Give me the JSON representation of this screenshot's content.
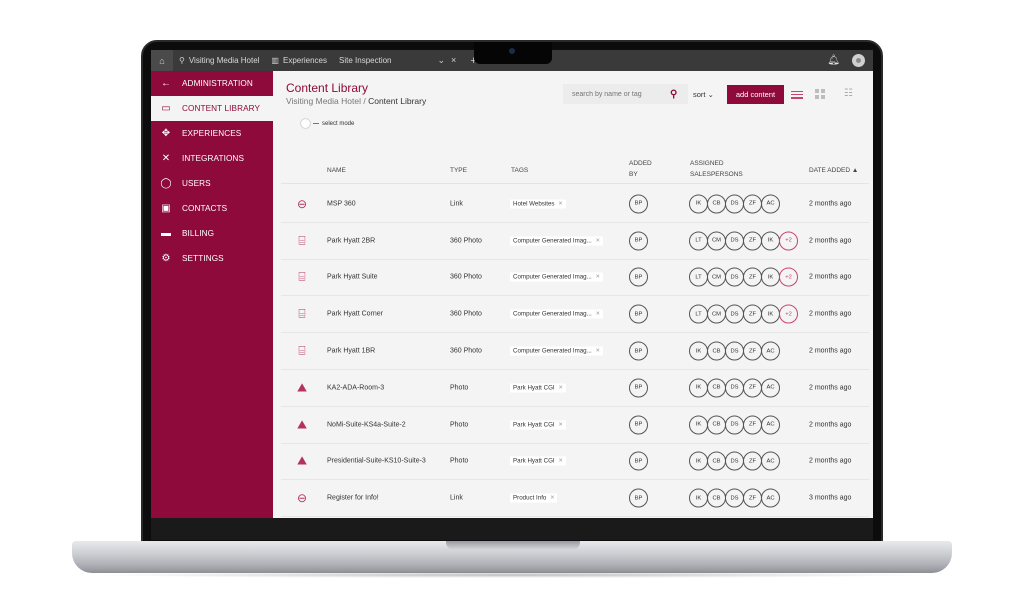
{
  "topbar": {
    "home_icon": "home-icon",
    "tabs": [
      {
        "icon": "location-pin-icon",
        "label": "Visiting Media Hotel"
      },
      {
        "icon": "map-book-icon",
        "label": "Experiences"
      },
      {
        "icon": "",
        "label": "Site Inspection"
      }
    ],
    "chevron": "⌄",
    "close": "×",
    "plus": "+",
    "bell": "♫",
    "bell_icon": "bell-icon",
    "avatar_icon": "user-avatar-icon"
  },
  "sidebar": {
    "items": [
      {
        "icon": "←",
        "label": "ADMINISTRATION",
        "active": false
      },
      {
        "icon": "▭",
        "label": "CONTENT LIBRARY",
        "active": true
      },
      {
        "icon": "✥",
        "label": "EXPERIENCES",
        "active": false
      },
      {
        "icon": "✕",
        "label": "INTEGRATIONS",
        "active": false
      },
      {
        "icon": "◯",
        "label": "USERS",
        "active": false
      },
      {
        "icon": "▣",
        "label": "CONTACTS",
        "active": false
      },
      {
        "icon": "▬",
        "label": "BILLING",
        "active": false
      },
      {
        "icon": "⚙",
        "label": "SETTINGS",
        "active": false
      }
    ]
  },
  "header": {
    "title": "Content Library",
    "breadcrumb_root": "Visiting Media Hotel",
    "breadcrumb_sep": "/",
    "breadcrumb_current": "Content Library",
    "select_mode_label": "select mode",
    "search_placeholder": "search by name or tag",
    "search_value": "",
    "sort_label": "sort ⌄",
    "add_button": "add content"
  },
  "table": {
    "columns": {
      "name": "NAME",
      "type": "TYPE",
      "tags": "TAGS",
      "added_by_1": "ADDED",
      "added_by_2": "BY",
      "assigned_1": "ASSIGNED",
      "assigned_2": "SALESPERSONS",
      "date_added": "DATE ADDED ▲"
    },
    "rows": [
      {
        "icon": "link-icon",
        "glyph": "⊖",
        "name": "MSP 360",
        "type": "Link",
        "tag": "Hotel Websites",
        "added_by": "BP",
        "salespersons": [
          "IK",
          "CB",
          "DS",
          "ZF",
          "AC"
        ],
        "more": "",
        "date": "2 months ago"
      },
      {
        "icon": "360-photo-icon",
        "glyph": "⌸",
        "name": "Park Hyatt 2BR",
        "type": "360 Photo",
        "tag": "Computer Generated Imag...",
        "added_by": "BP",
        "salespersons": [
          "LT",
          "CM",
          "DS",
          "ZF",
          "IK"
        ],
        "more": "+2",
        "date": "2 months ago"
      },
      {
        "icon": "360-photo-icon",
        "glyph": "⌸",
        "name": "Park Hyatt Suite",
        "type": "360 Photo",
        "tag": "Computer Generated Imag...",
        "added_by": "BP",
        "salespersons": [
          "LT",
          "CM",
          "DS",
          "ZF",
          "IK"
        ],
        "more": "+2",
        "date": "2 months ago"
      },
      {
        "icon": "360-photo-icon",
        "glyph": "⌸",
        "name": "Park Hyatt Corner",
        "type": "360 Photo",
        "tag": "Computer Generated Imag...",
        "added_by": "BP",
        "salespersons": [
          "LT",
          "CM",
          "DS",
          "ZF",
          "IK"
        ],
        "more": "+2",
        "date": "2 months ago"
      },
      {
        "icon": "360-photo-icon",
        "glyph": "⌸",
        "name": "Park Hyatt 1BR",
        "type": "360 Photo",
        "tag": "Computer Generated Imag...",
        "added_by": "BP",
        "salespersons": [
          "IK",
          "CB",
          "DS",
          "ZF",
          "AC"
        ],
        "more": "",
        "date": "2 months ago"
      },
      {
        "icon": "photo-icon",
        "glyph": "⛰",
        "name": "KA2-ADA-Room-3",
        "type": "Photo",
        "tag": "Park Hyatt CGI",
        "added_by": "BP",
        "salespersons": [
          "IK",
          "CB",
          "DS",
          "ZF",
          "AC"
        ],
        "more": "",
        "date": "2 months ago"
      },
      {
        "icon": "photo-icon",
        "glyph": "⛰",
        "name": "NoMi-Suite-KS4a-Suite-2",
        "type": "Photo",
        "tag": "Park Hyatt CGI",
        "added_by": "BP",
        "salespersons": [
          "IK",
          "CB",
          "DS",
          "ZF",
          "AC"
        ],
        "more": "",
        "date": "2 months ago"
      },
      {
        "icon": "photo-icon",
        "glyph": "⛰",
        "name": "Presidential-Suite-KS10-Suite-3",
        "type": "Photo",
        "tag": "Park Hyatt CGI",
        "added_by": "BP",
        "salespersons": [
          "IK",
          "CB",
          "DS",
          "ZF",
          "AC"
        ],
        "more": "",
        "date": "2 months ago"
      },
      {
        "icon": "link-icon",
        "glyph": "⊖",
        "name": "Register for Info!",
        "type": "Link",
        "tag": "Product Info",
        "added_by": "BP",
        "salespersons": [
          "IK",
          "CB",
          "DS",
          "ZF",
          "AC"
        ],
        "more": "",
        "date": "3 months ago"
      }
    ]
  },
  "colors": {
    "brand": "#8e0a3a",
    "accent": "#c8446f",
    "background": "#f4f4f4",
    "topbar": "#3a3a3a"
  }
}
